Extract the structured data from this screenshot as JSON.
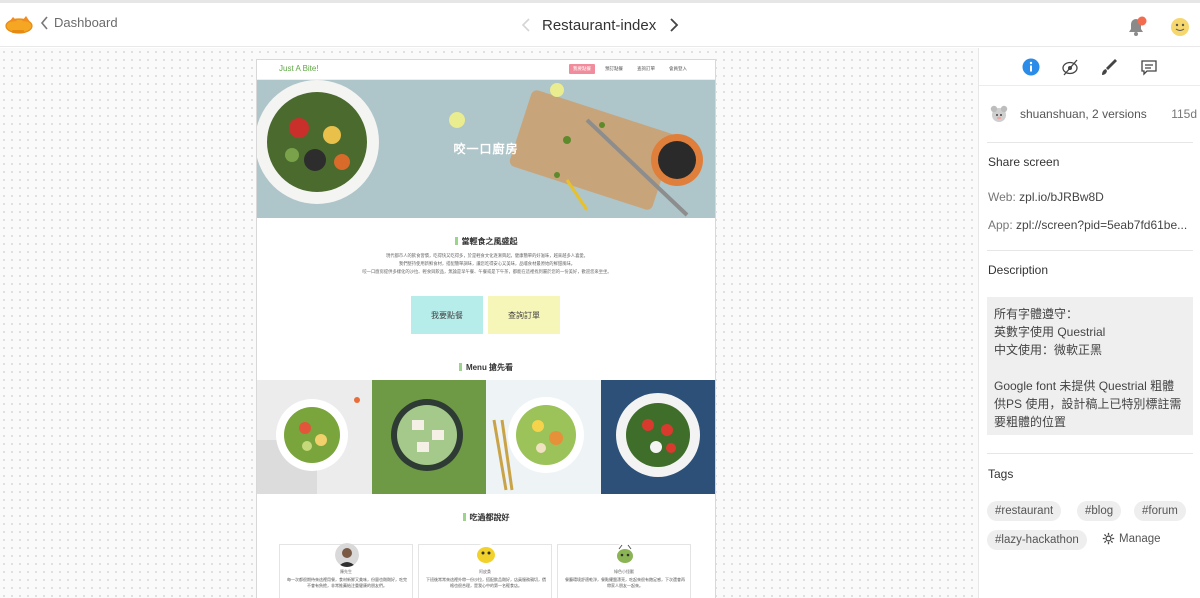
{
  "header": {
    "back_label": "Dashboard",
    "screen_title": "Restaurant-index"
  },
  "mockup": {
    "brand": "Just A Bite!",
    "nav_links": [
      "我要點餐",
      "預訂點餐",
      "查詢訂單",
      "會員登入"
    ],
    "hero_title": "咬一口廚房",
    "section1_title": "當輕食之風盛起",
    "section1_lines": [
      "現代都市人的飲食習慣，吃得快又吃得多，於是輕食文化逐漸興起，健康簡單的好滋味，越來越多人喜愛。",
      "我們堅持使用新鮮食材，搭配簡單調味，讓您吃得安心又美味，品嚐食材最原始的鮮甜風味。",
      "咬一口廚房提供多樣化的沙拉、輕食與飲品，無論是早午餐、午餐或是下午茶，都能在這裡找到屬於您的一份美好，歡迎您來坐坐。"
    ],
    "order_button": "我要點餐",
    "query_button": "查詢訂單",
    "menu_title": "Menu 搶先看",
    "reviews_title": "吃過都說好",
    "reviews": [
      {
        "name": "陳先生",
        "text": "每一次都很期待來這裡用餐，食材新鮮又美味，份量也剛剛好，吃完不會有負擔，非常推薦給注重健康的朋友們。"
      },
      {
        "name": "阿皮桑",
        "text": "下班後常常來這裡外帶一份沙拉，搭配飲品剛好，店員服務親切，價格也很合理，是我心中的第一名輕食店。"
      },
      {
        "name": "綠色小怪獸",
        "text": "餐廳環境舒適乾淨，餐點擺盤漂亮，吃起來很有飽足感，下次還會再帶家人朋友一起來。"
      }
    ]
  },
  "panel": {
    "owner": "shuanshuan, 2 versions",
    "age": "115d",
    "share_heading": "Share screen",
    "web_label": "Web:",
    "web_value": "zpl.io/bJRBw8D",
    "app_label": "App:",
    "app_value": "zpl://screen?pid=5eab7fd61be...",
    "description_heading": "Description",
    "description": "所有字體遵守：\n英數字使用 Questrial\n中文使用：微軟正黑\n\nGoogle font 未提供 Questrial 粗體\n供PS 使用，設計稿上已特別標註需要粗體的位置",
    "tags_heading": "Tags",
    "tags": [
      "#restaurant",
      "#blog",
      "#forum",
      "#lazy-hackathon"
    ],
    "manage_label": "Manage"
  },
  "colors": {
    "accent_blue": "#2a8be8",
    "brand_orange": "#f5a623",
    "mockup_green": "#9bd48a",
    "mockup_pink": "#f08c9b",
    "button_mint": "#b6ecea",
    "button_yellow": "#f7f6b9"
  },
  "icons": [
    "zeplin-logo-icon",
    "chevron-left-icon",
    "chevron-right-icon",
    "notification-bell-icon",
    "user-avatar-icon",
    "info-icon",
    "eye-slash-icon",
    "brush-icon",
    "comment-icon",
    "owner-avatar-icon",
    "gear-icon"
  ]
}
